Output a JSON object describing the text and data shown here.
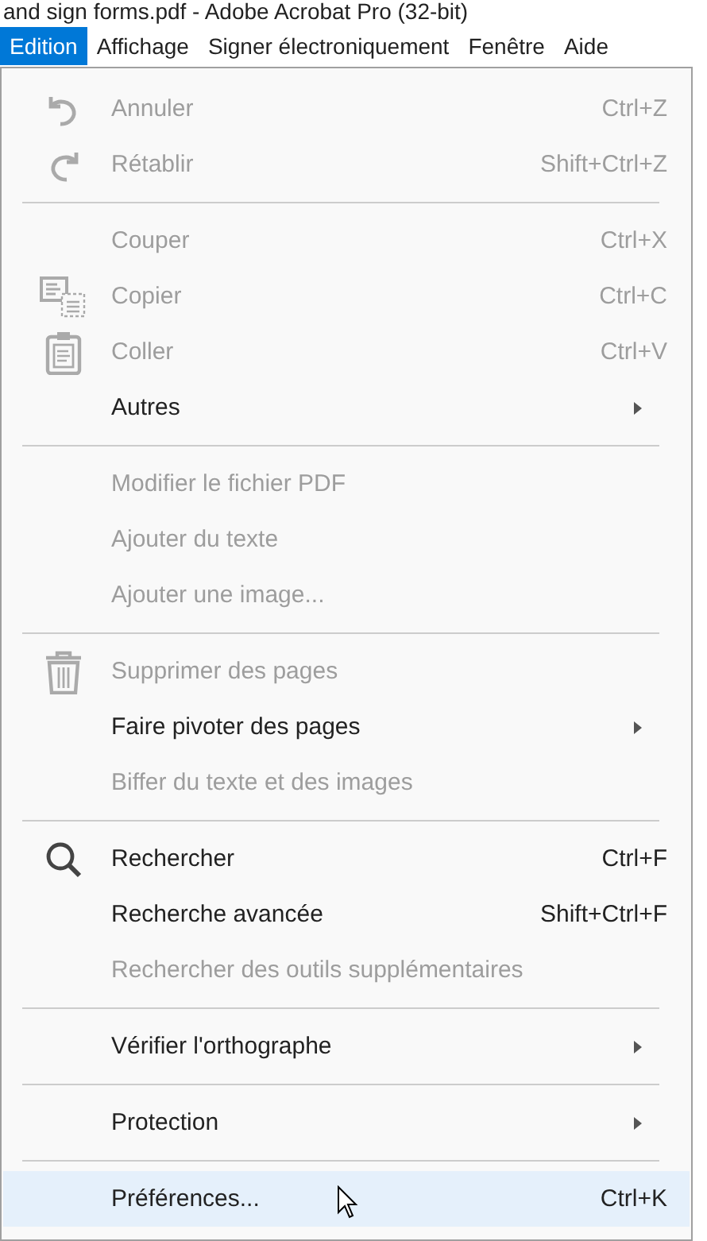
{
  "window": {
    "title": "and sign forms.pdf - Adobe Acrobat Pro (32-bit)"
  },
  "menubar": [
    {
      "label": "Edition",
      "selected": true
    },
    {
      "label": "Affichage",
      "selected": false
    },
    {
      "label": "Signer électroniquement",
      "selected": false
    },
    {
      "label": "Fenêtre",
      "selected": false
    },
    {
      "label": "Aide",
      "selected": false
    }
  ],
  "menu": [
    {
      "kind": "undo",
      "label": "Annuler",
      "shortcut": "Ctrl+Z",
      "disabled": true,
      "submenu": false,
      "selected": false
    },
    {
      "kind": "redo",
      "label": "Rétablir",
      "shortcut": "Shift+Ctrl+Z",
      "disabled": true,
      "submenu": false,
      "selected": false
    },
    {
      "kind": "separator"
    },
    {
      "kind": "item",
      "label": "Couper",
      "shortcut": "Ctrl+X",
      "disabled": true,
      "submenu": false,
      "selected": false
    },
    {
      "kind": "copy",
      "label": "Copier",
      "shortcut": "Ctrl+C",
      "disabled": true,
      "submenu": false,
      "selected": false
    },
    {
      "kind": "paste",
      "label": "Coller",
      "shortcut": "Ctrl+V",
      "disabled": true,
      "submenu": false,
      "selected": false
    },
    {
      "kind": "item",
      "label": "Autres",
      "disabled": false,
      "submenu": true,
      "selected": false
    },
    {
      "kind": "separator"
    },
    {
      "kind": "item",
      "label": "Modifier le fichier PDF",
      "disabled": true,
      "submenu": false,
      "selected": false
    },
    {
      "kind": "item",
      "label": "Ajouter du texte",
      "disabled": true,
      "submenu": false,
      "selected": false
    },
    {
      "kind": "item",
      "label": "Ajouter une image...",
      "disabled": true,
      "submenu": false,
      "selected": false
    },
    {
      "kind": "separator"
    },
    {
      "kind": "delete",
      "label": "Supprimer des pages",
      "disabled": true,
      "submenu": false,
      "selected": false
    },
    {
      "kind": "item",
      "label": "Faire pivoter des pages",
      "disabled": false,
      "submenu": true,
      "selected": false
    },
    {
      "kind": "item",
      "label": "Biffer du texte et des images",
      "disabled": true,
      "submenu": false,
      "selected": false
    },
    {
      "kind": "separator"
    },
    {
      "kind": "search",
      "label": "Rechercher",
      "shortcut": "Ctrl+F",
      "disabled": false,
      "submenu": false,
      "selected": false
    },
    {
      "kind": "item",
      "label": "Recherche avancée",
      "shortcut": "Shift+Ctrl+F",
      "disabled": false,
      "submenu": false,
      "selected": false
    },
    {
      "kind": "item",
      "label": "Rechercher des outils supplémentaires",
      "disabled": true,
      "submenu": false,
      "selected": false
    },
    {
      "kind": "separator"
    },
    {
      "kind": "item",
      "label": "Vérifier l'orthographe",
      "disabled": false,
      "submenu": true,
      "selected": false
    },
    {
      "kind": "separator"
    },
    {
      "kind": "item",
      "label": "Protection",
      "disabled": false,
      "submenu": true,
      "selected": false
    },
    {
      "kind": "separator"
    },
    {
      "kind": "item",
      "label": "Préférences...",
      "shortcut": "Ctrl+K",
      "disabled": false,
      "submenu": false,
      "selected": true
    }
  ]
}
